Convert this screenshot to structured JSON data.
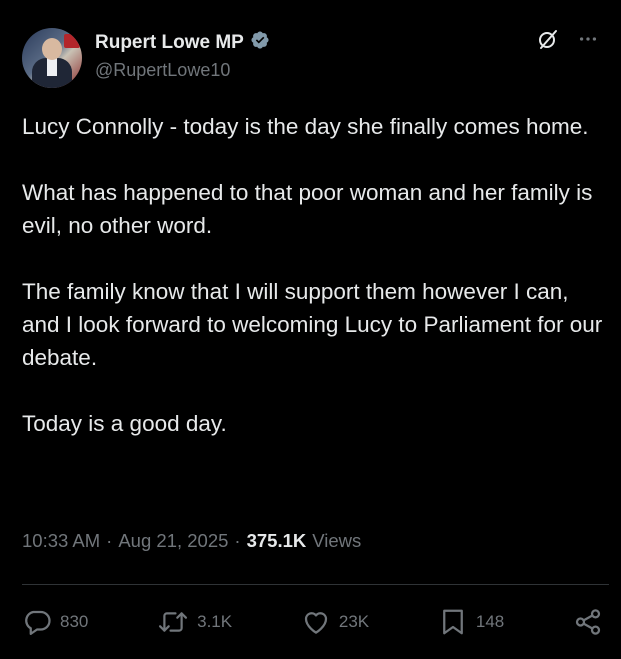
{
  "author": {
    "display_name": "Rupert Lowe MP",
    "handle": "@RupertLowe10",
    "verified_color": "#829aab"
  },
  "post": {
    "paragraphs": [
      "Lucy Connolly - today is the day she finally comes home.",
      "What has happened to that poor woman and her family is evil, no other word.",
      "The family know that I will support them however I can, and I look forward to welcoming Lucy to Parliament for our debate.",
      "Today is a good day."
    ],
    "time": "10:33 AM",
    "date": "Aug 21, 2025",
    "views_count": "375.1K",
    "views_label": "Views"
  },
  "actions": {
    "replies": "830",
    "reposts": "3.1K",
    "likes": "23K",
    "bookmarks": "148"
  },
  "icons": [
    "grok-icon",
    "more-icon",
    "verified-badge-icon",
    "reply-icon",
    "repost-icon",
    "like-icon",
    "bookmark-icon",
    "share-icon"
  ],
  "colors": {
    "background": "#000000",
    "text": "#e7e9ea",
    "secondary": "#71767b",
    "divider": "#2f3336"
  }
}
